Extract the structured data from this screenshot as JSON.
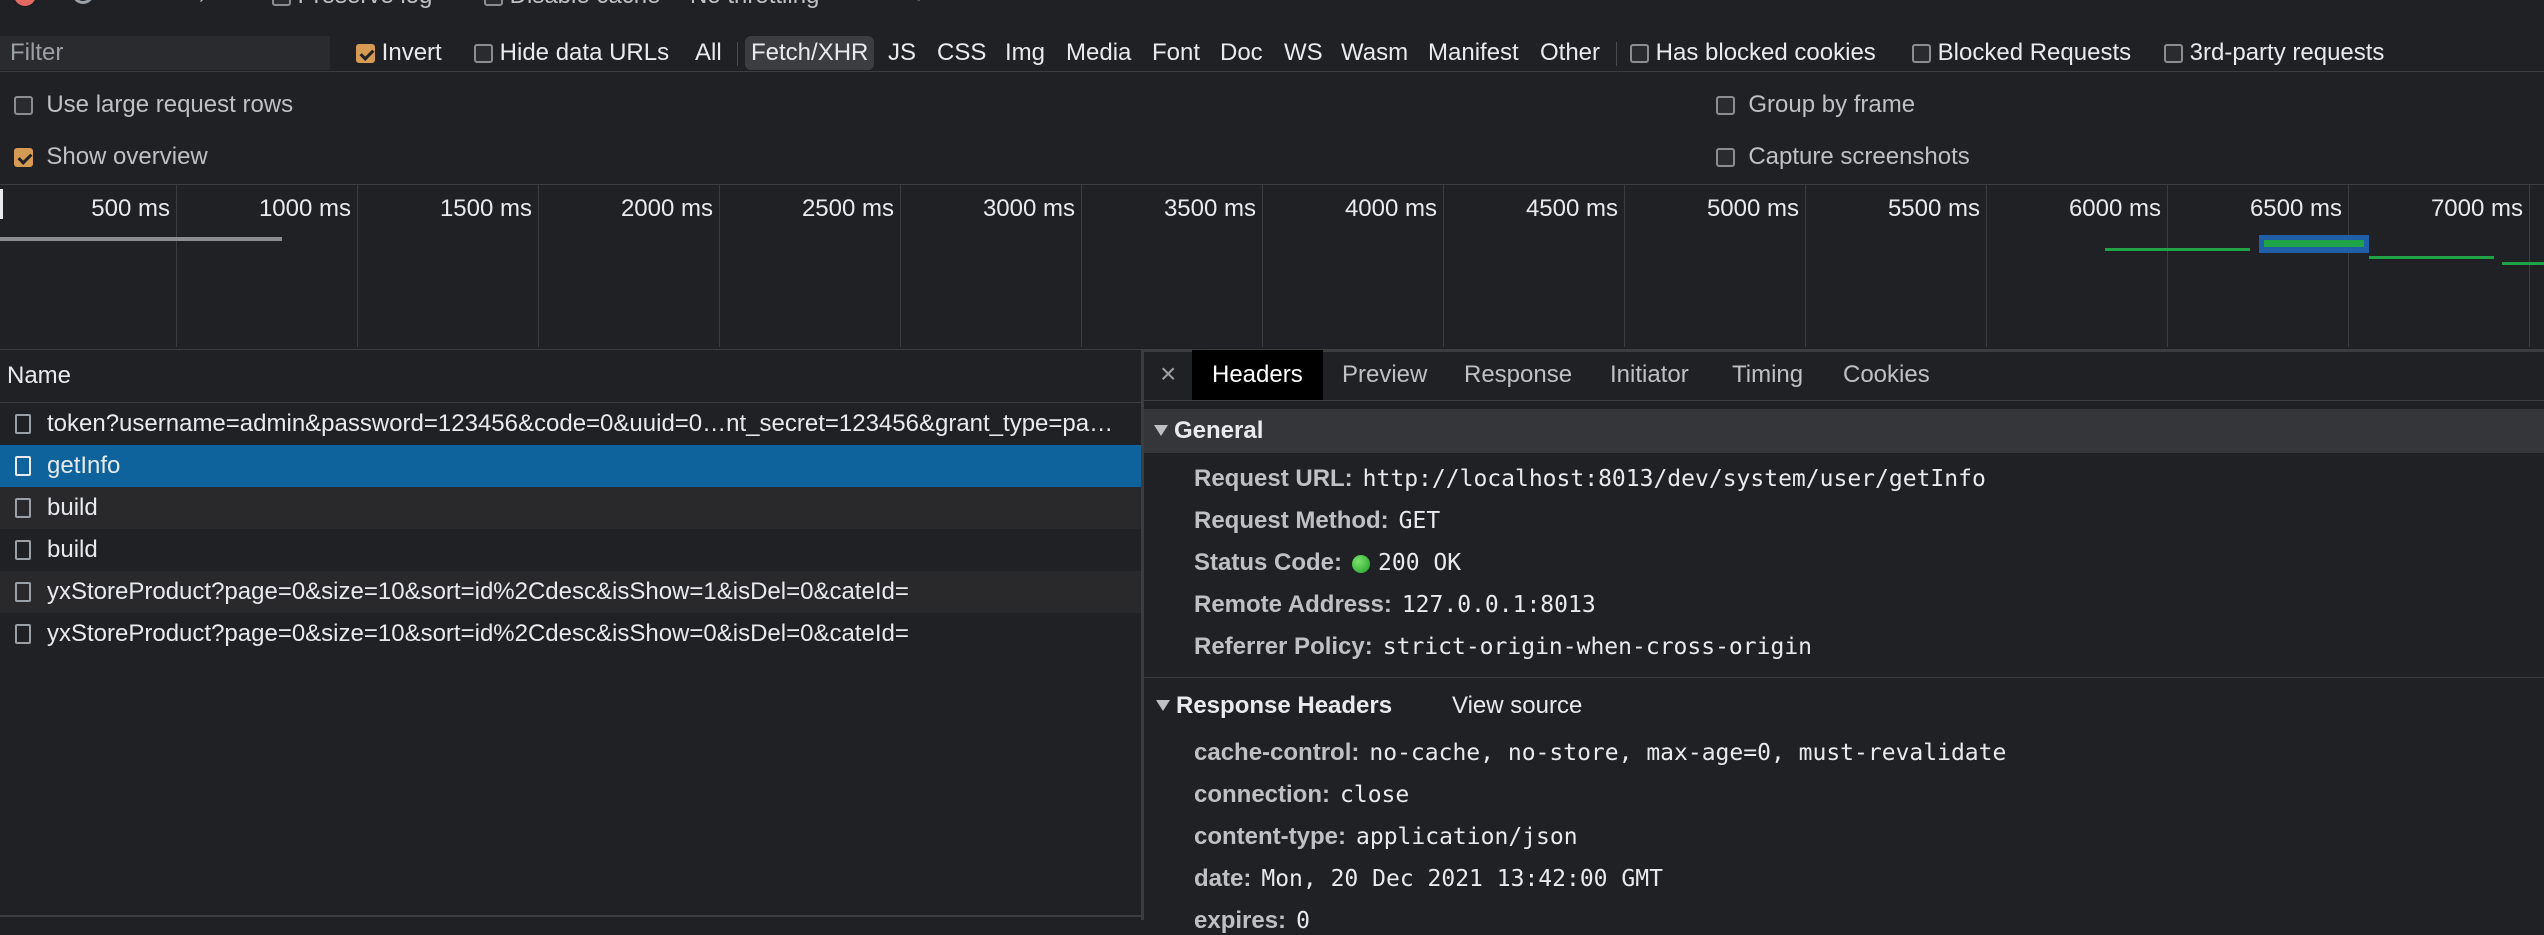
{
  "toolbar": {
    "preserve_log": "Preserve log",
    "disable_cache": "Disable cache",
    "throttling": "No throttling"
  },
  "filter_bar": {
    "filter_placeholder": "Filter",
    "invert": "Invert",
    "hide_data_urls": "Hide data URLs",
    "types": [
      "All",
      "Fetch/XHR",
      "JS",
      "CSS",
      "Img",
      "Media",
      "Font",
      "Doc",
      "WS",
      "Wasm",
      "Manifest",
      "Other"
    ],
    "active_type": "Fetch/XHR",
    "has_blocked_cookies": "Has blocked cookies",
    "blocked_requests": "Blocked Requests",
    "third_party": "3rd-party requests"
  },
  "settings": {
    "large_rows": "Use large request rows",
    "show_overview": "Show overview",
    "group_by_frame": "Group by frame",
    "capture_screenshots": "Capture screenshots"
  },
  "overview": {
    "ticks": [
      "500 ms",
      "1000 ms",
      "1500 ms",
      "2000 ms",
      "2500 ms",
      "3000 ms",
      "3500 ms",
      "4000 ms",
      "4500 ms",
      "5000 ms",
      "5500 ms",
      "6000 ms",
      "6500 ms",
      "7000 ms"
    ]
  },
  "request_list": {
    "header": "Name",
    "rows": [
      {
        "name": "token?username=admin&password=123456&code=0&uuid=0…nt_secret=123456&grant_type=pa…"
      },
      {
        "name": "getInfo"
      },
      {
        "name": "build"
      },
      {
        "name": "build"
      },
      {
        "name": "yxStoreProduct?page=0&size=10&sort=id%2Cdesc&isShow=1&isDel=0&cateId="
      },
      {
        "name": "yxStoreProduct?page=0&size=10&sort=id%2Cdesc&isShow=0&isDel=0&cateId="
      }
    ]
  },
  "details": {
    "close": "×",
    "tabs": [
      "Headers",
      "Preview",
      "Response",
      "Initiator",
      "Timing",
      "Cookies"
    ],
    "general": {
      "title": "General",
      "request_url_k": "Request URL:",
      "request_url_v": "http://localhost:8013/dev/system/user/getInfo",
      "method_k": "Request Method:",
      "method_v": "GET",
      "status_k": "Status Code:",
      "status_v": "200 OK",
      "remote_k": "Remote Address:",
      "remote_v": "127.0.0.1:8013",
      "referrer_k": "Referrer Policy:",
      "referrer_v": "strict-origin-when-cross-origin"
    },
    "response_headers": {
      "title": "Response Headers",
      "view_source": "View source",
      "cache_k": "cache-control:",
      "cache_v": "no-cache, no-store, max-age=0, must-revalidate",
      "connection_k": "connection:",
      "connection_v": "close",
      "ctype_k": "content-type:",
      "ctype_v": "application/json",
      "date_k": "date:",
      "date_v": "Mon, 20 Dec 2021 13:42:00 GMT",
      "expires_k": "expires:",
      "expires_v": "0"
    }
  }
}
